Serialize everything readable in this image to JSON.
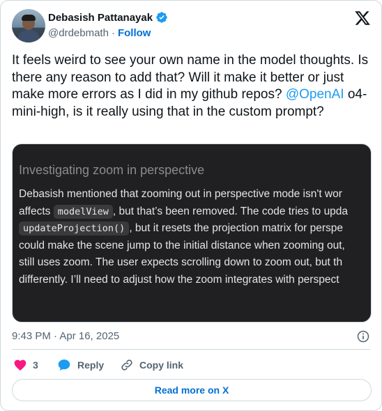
{
  "author": {
    "display_name": "Debasish Pattanayak",
    "handle": "@drdebmath",
    "separator": "·",
    "follow_label": "Follow"
  },
  "tweet": {
    "text_before": "It feels weird to see your own name in the model thoughts. Is there any reason to add that? Will it make it better or just make more errors as I did in my github repos? ",
    "mention": "@OpenAI",
    "text_after": " o4-mini-high, is it really using that in the custom prompt?"
  },
  "media": {
    "title": "Investigating zoom in perspective",
    "line1": "Debasish mentioned that zooming out in perspective mode isn't wor",
    "line2_a": "affects ",
    "line2_code": "modelView",
    "line2_b": ", but that’s been removed. The code tries to upda",
    "line3_code": "updateProjection()",
    "line3_b": ", but it resets the projection matrix for perspe",
    "line4": "could make the scene jump to the initial distance when zooming out,",
    "line5": "still uses zoom. The user expects scrolling down to zoom out, but th",
    "line6": "differently. I’ll need to adjust how the zoom integrates with perspect"
  },
  "meta": {
    "timestamp": "9:43 PM · Apr 16, 2025"
  },
  "actions": {
    "like_count": "3",
    "reply_label": "Reply",
    "copy_label": "Copy link"
  },
  "footer": {
    "read_more_label": "Read more on X"
  },
  "colors": {
    "like": "#f91880",
    "reply": "#1d9bf0",
    "link": "#006fd6",
    "verified": "#1d9bf0"
  },
  "icons": [
    "verified-badge-icon",
    "x-logo-icon",
    "info-icon",
    "heart-icon",
    "reply-bubble-icon",
    "link-icon"
  ]
}
